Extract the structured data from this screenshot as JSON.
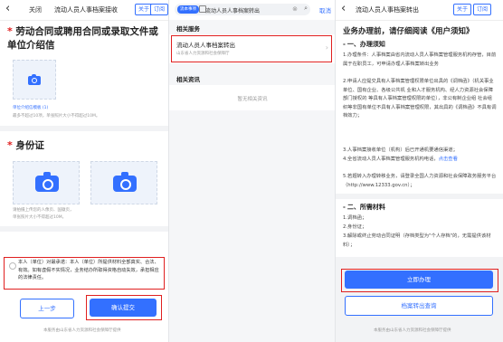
{
  "panel1": {
    "back_icon": "chevron-left",
    "close_label": "关闭",
    "title": "流动人员人事档案接收",
    "pill_1": "关于",
    "pill_2": "订阅",
    "section1": {
      "star": "*",
      "title": "劳动合同或聘用合同或录取文件或单位介绍信",
      "link": "单位介绍信模板 (1)",
      "hint": "最多不超过10项，单张照片大小不得超过10M。"
    },
    "section2": {
      "star": "*",
      "title": "身份证",
      "hint_1": "请拍摄上传您的人像页、国徽页，",
      "hint_2": "单张照片大小不得超过10M。"
    },
    "agreement": "本人（单位）对最承诺：本人（单位）所提供材料全部真实、合法、有效。如有虚假不实情况，业务结办所取得资格自动失效，承担相应的法律责任。",
    "prev_button": "上一步",
    "submit_button": "确认提交",
    "footer": "本服务由山东省人力资源和社会保障厅提供"
  },
  "panel2": {
    "search_tag": "流本事项",
    "search_value": "流动人员人事档案转出",
    "cancel_label": "取消",
    "section_service": "相关服务",
    "result_title": "流动人员人事档案转出",
    "result_sub": "山东省人力资源和社会保障厅",
    "section_news": "相关资讯",
    "no_news": "暂无相关资讯"
  },
  "panel3": {
    "title": "流动人员人事档案转出",
    "pill_1": "关于",
    "pill_2": "订阅",
    "heading": "业务办理前，请仔细阅读《用户须知》",
    "notice_head": "一、办理须知",
    "notice_lines": [
      "1.办理条件：人事档案由省内流动人员人事档案管理服务机构存管，目前属于在职员工，可申请办理人事档案转出业务",
      "2.申请人应提交具有人事档案管理权限单位出具的《调档函》（机关事业单位、国有企业、各级公共机 业和人才服务机构、经人力资源社会保障部门授权的 等具有人事档案管理权限的单位），非公有制企业组 社会组织等非国有单位不具有人事档案管理权限，其出具的《调档函》不具有调档效力；",
      "3.人事档案接收单位（机构）后已开通机要通信渠道；",
      "4.全省流动人员人事档案管理服务机构电话，",
      "5.若题转入办理转移业务，请登录全国人力资源和社会保障政务服务平台（http://www.12333.gov.cn）；"
    ],
    "phone_link": "点击查看",
    "materials_head": "二、所需材料",
    "materials": [
      "1.调档函；",
      "2.身份证；",
      "3.解除或终止劳动合同证明（存档类型为\"个人存档\"的，无需提供该材料）；"
    ],
    "apply_button": "立即办理",
    "query_button": "档案转出查询",
    "footer": "本服务由山东省人力资源和社会保障厅提供"
  },
  "colors": {
    "accent": "#3370ff",
    "highlight": "#e02020"
  }
}
